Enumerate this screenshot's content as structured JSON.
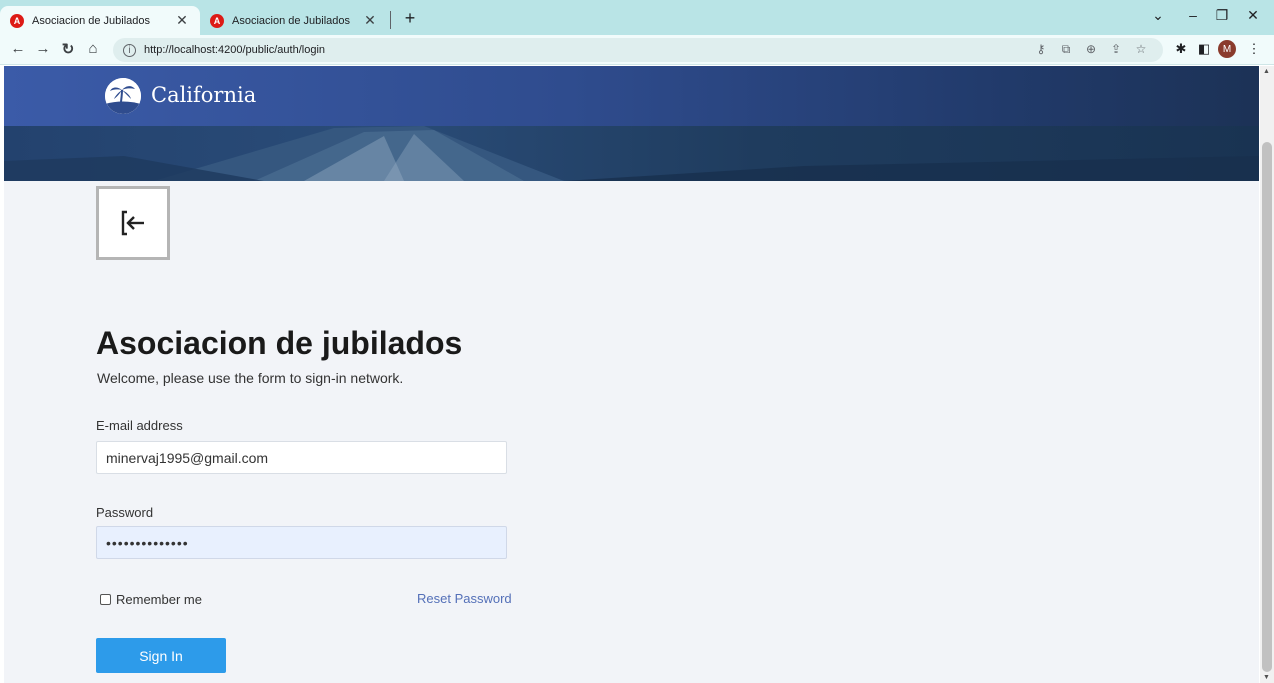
{
  "browser": {
    "tabs": [
      {
        "title": "Asociacion de Jubilados",
        "active": true
      },
      {
        "title": "Asociacion de Jubilados",
        "active": false
      }
    ],
    "favicon_letter": "A",
    "url": "http://localhost:4200/public/auth/login",
    "profile_initial": "M",
    "colors": {
      "tabstrip": "#b9e4e6",
      "toolbar": "#f1fbfb"
    }
  },
  "header": {
    "brand": "California",
    "colors": {
      "header": "#3b5ba8",
      "banner": "#23426e"
    }
  },
  "login": {
    "title": "Asociacion de jubilados",
    "subtitle": "Welcome, please use the form to sign-in network.",
    "email_label": "E-mail address",
    "email_value": "minervaj1995@gmail.com",
    "password_label": "Password",
    "password_value": "••••••••••••••",
    "remember_label": "Remember me",
    "remember_checked": false,
    "reset_label": "Reset Password",
    "signin_label": "Sign In",
    "colors": {
      "button": "#2d9bea",
      "link": "#5470b8",
      "autofill": "#e8f0fe"
    }
  }
}
